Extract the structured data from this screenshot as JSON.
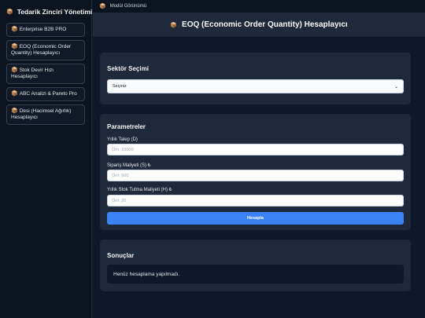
{
  "sidebar": {
    "title": "Tedarik Zinciri Yönetimi",
    "items": [
      {
        "label": "Enterprise B2B PRO"
      },
      {
        "label": "EOQ (Economic Order Quantity) Hesaplayıcı"
      },
      {
        "label": "Stok Devir Hızı Hesaplayıcı"
      },
      {
        "label": "ABC Analizi & Pareto Pro"
      },
      {
        "label": "Desi (Hacimsel Ağırlık) Hesaplayıcı"
      }
    ]
  },
  "topbar": {
    "label": "Modül Görünümü"
  },
  "header": {
    "title": "EOQ (Economic Order Quantity) Hesaplayıcı"
  },
  "sector": {
    "title": "Sektör Seçimi",
    "select_value": "Seçiniz"
  },
  "params": {
    "title": "Parametreler",
    "demand_label": "Yıllık Talep (D)",
    "demand_placeholder": "Örn: 10000",
    "order_cost_label": "Sipariş Maliyeti (S) ₺",
    "order_cost_placeholder": "Örn: 500",
    "holding_cost_label": "Yıllık Stok Tutma Maliyeti (H) ₺",
    "holding_cost_placeholder": "Örn: 20",
    "calculate_label": "Hesapla"
  },
  "results": {
    "title": "Sonuçlar",
    "empty_text": "Henüz hesaplama yapılmadı."
  },
  "icons": {
    "module": "package-icon"
  },
  "colors": {
    "accent": "#3b82f6",
    "card_bg": "#1e293b",
    "page_bg": "#0f172a"
  }
}
